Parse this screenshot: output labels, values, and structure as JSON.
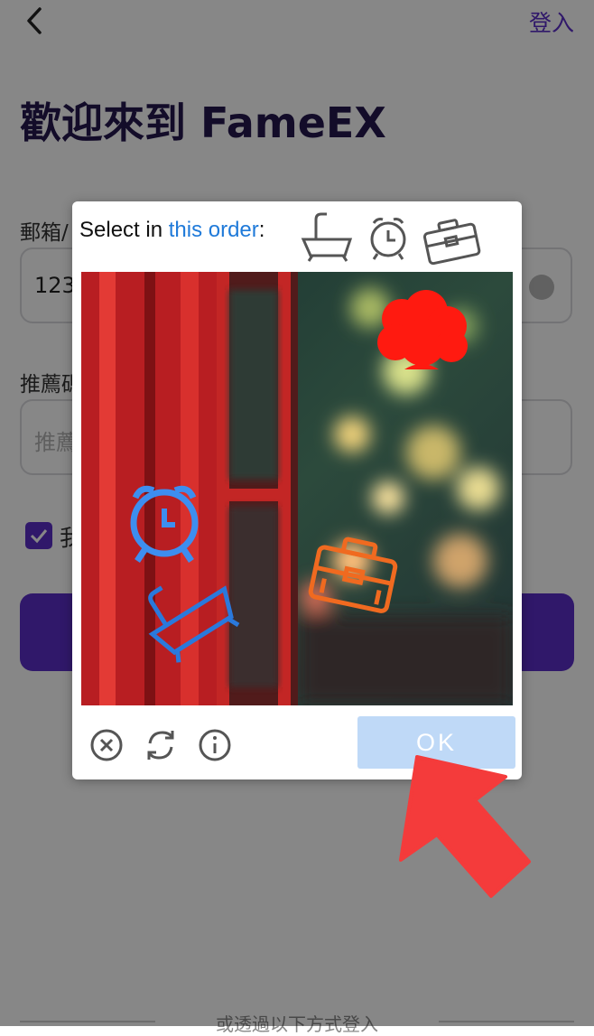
{
  "header": {
    "login_label": "登入"
  },
  "title": "歡迎來到 FameEX",
  "form": {
    "email_label": "郵箱/",
    "email_value": "123",
    "referral_label": "推薦碼",
    "referral_placeholder": "推薦",
    "agree_text": "我"
  },
  "footer": {
    "alt_login_text": "或透過以下方式登入"
  },
  "captcha": {
    "instruction_prefix": "Select in ",
    "instruction_highlight": "this order",
    "instruction_suffix": ":",
    "order_icons": [
      "bathtub-icon",
      "alarm-clock-icon",
      "suitcase-icon"
    ],
    "ok_label": "OK",
    "tools": [
      "close-icon",
      "refresh-icon",
      "info-icon"
    ]
  },
  "colors": {
    "brand": "#5b2fc9",
    "link_blue": "#1f7ad9",
    "ok_button": "#bfd9f7",
    "annotation_arrow": "#f43b3b"
  }
}
